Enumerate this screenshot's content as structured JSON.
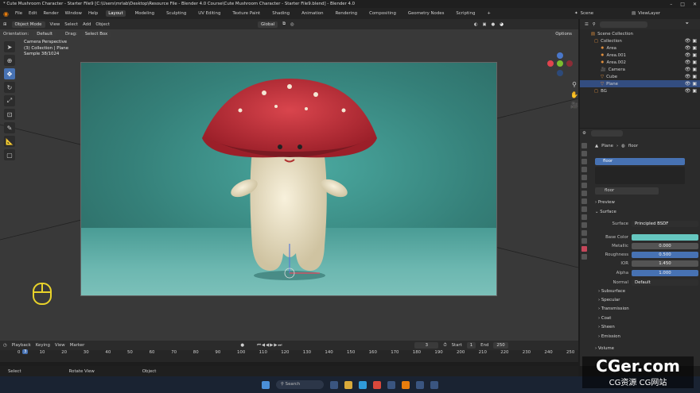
{
  "window": {
    "title": "* Cute Mushroom Character - Starter File9 [C:\\Users\\mrlab\\Desktop\\Resource File - Blender 4.0 Course\\Cute Mushroom Character - Starter File9.blend] - Blender 4.0",
    "controls": [
      "–",
      "□",
      "✕"
    ]
  },
  "menu": {
    "items": [
      "File",
      "Edit",
      "Render",
      "Window",
      "Help"
    ],
    "workspaces": [
      "Layout",
      "Modeling",
      "Sculpting",
      "UV Editing",
      "Texture Paint",
      "Shading",
      "Animation",
      "Rendering",
      "Compositing",
      "Geometry Nodes",
      "Scripting"
    ],
    "add_tab": "+",
    "scene_label": "Scene",
    "viewlayer_label": "ViewLayer"
  },
  "header": {
    "mode": "Object Mode",
    "view": "View",
    "select": "Select",
    "add": "Add",
    "object": "Object",
    "transform": "Global"
  },
  "header2": {
    "orientation_label": "Orientation:",
    "orientation": "Default",
    "drag_label": "Drag:",
    "drag": "Select Box",
    "options": "Options"
  },
  "viewport": {
    "line1": "Camera Perspective",
    "line2": "(3) Collection | Plane",
    "line3": "Sample 38/1024"
  },
  "nav": {
    "x": "X",
    "y": "Y",
    "z": "Z"
  },
  "timeline": {
    "menu": [
      "Playback",
      "Keying",
      "View",
      "Marker"
    ],
    "current_frame": "3",
    "start_label": "Start",
    "start": "1",
    "end_label": "End",
    "end": "250",
    "ticks": [
      "0",
      "10",
      "20",
      "30",
      "40",
      "50",
      "60",
      "70",
      "80",
      "90",
      "100",
      "110",
      "120",
      "130",
      "140",
      "150",
      "160",
      "170",
      "180",
      "190",
      "200",
      "210",
      "220",
      "230",
      "240",
      "250"
    ],
    "marker": "3"
  },
  "status": {
    "select": "Select",
    "rotate": "Rotate View",
    "object": "Object"
  },
  "taskbar": {
    "search": "Search"
  },
  "outliner": {
    "search": "",
    "rows": [
      {
        "name": "Scene Collection"
      },
      {
        "name": "Collection"
      },
      {
        "name": "Area"
      },
      {
        "name": "Area.001"
      },
      {
        "name": "Area.002"
      },
      {
        "name": "Camera"
      },
      {
        "name": "Cube"
      },
      {
        "name": "Plane"
      },
      {
        "name": "BG"
      }
    ]
  },
  "properties": {
    "breadcrumb": [
      "Plane",
      "floor"
    ],
    "material_slot": "floor",
    "material_name": "floor",
    "sections": {
      "preview": "Preview",
      "surface": "Surface",
      "subsurface": "Subsurface",
      "specular": "Specular",
      "transmission": "Transmission",
      "coat": "Coat",
      "sheen": "Sheen",
      "emission": "Emission",
      "volume": "Volume"
    },
    "fields": [
      {
        "label": "Surface",
        "value": "Principled BSDF"
      },
      {
        "label": "Base Color",
        "value": ""
      },
      {
        "label": "Metallic",
        "value": "0.000"
      },
      {
        "label": "Roughness",
        "value": "0.500"
      },
      {
        "label": "IOR",
        "value": "1.450"
      },
      {
        "label": "Alpha",
        "value": "1.000"
      },
      {
        "label": "Normal",
        "value": "Default"
      }
    ]
  },
  "colors": {
    "accent": "#4772b3",
    "base_color": "#66c7c0",
    "selected_row": "#334d80"
  },
  "watermark": {
    "line1": "CGer.com",
    "line2": "CG资源 CG网站"
  }
}
